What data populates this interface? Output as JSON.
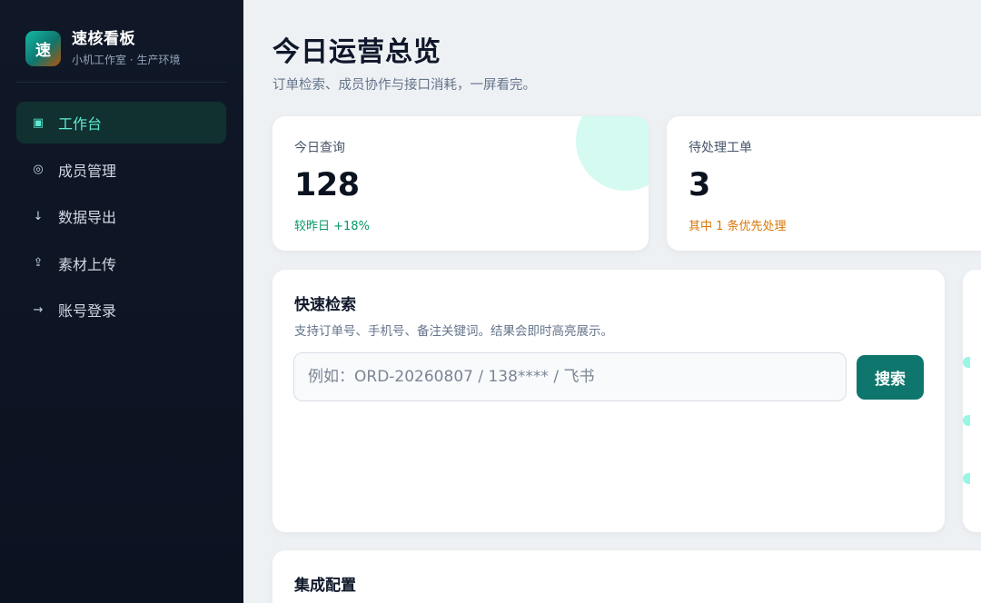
{
  "brand": {
    "logo_char": "速",
    "name": "速核看板",
    "subtitle": "小机工作室 · 生产环境"
  },
  "nav": {
    "items": [
      {
        "icon": "▣",
        "label": "工作台",
        "active": true
      },
      {
        "icon": "◎",
        "label": "成员管理"
      },
      {
        "icon": "↓",
        "label": "数据导出"
      },
      {
        "icon": "⇪",
        "label": "素材上传"
      },
      {
        "icon": "→",
        "label": "账号登录"
      }
    ]
  },
  "page": {
    "title": "今日运营总览",
    "subtitle": "订单检索、成员协作与接口消耗，一屏看完。"
  },
  "stats": [
    {
      "label": "今日查询",
      "value": "128",
      "note": "较昨日 +18%"
    },
    {
      "label": "待处理工单",
      "value": "3",
      "note": "其中 1 条优先处理"
    }
  ],
  "search": {
    "title": "快速检索",
    "description": "支持订单号、手机号、备注关键词。结果会即时高亮展示。",
    "placeholder": "例如：ORD-20260807 / 138**** / 飞书",
    "value": "",
    "button_label": "搜索"
  },
  "config": {
    "title": "集成配置"
  },
  "colors": {
    "sidebar_bg": "#0f172a",
    "accent": "#0f766e",
    "accent_text": "#5eead4",
    "positive": "#059669",
    "warning": "#d97706"
  }
}
